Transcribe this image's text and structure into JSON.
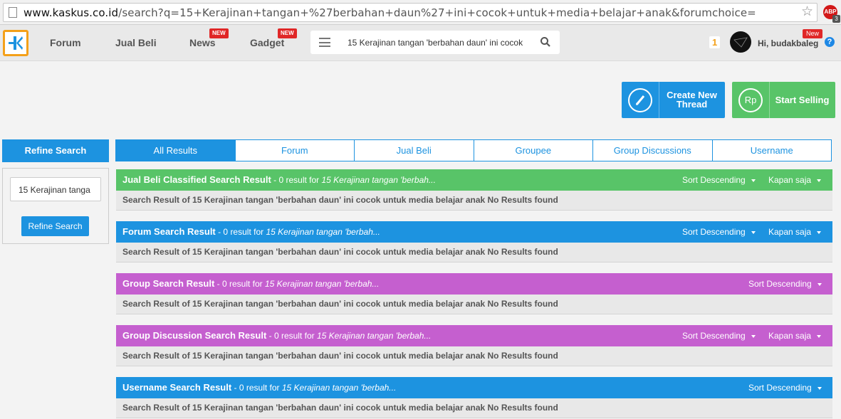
{
  "browser": {
    "url_host": "www.kaskus.co.id",
    "url_path": "/search?q=15+Kerajinan+tangan+%27berbahan+daun%27+ini+cocok+untuk+media+belajar+anak&forumchoice=",
    "star": "☆",
    "adblock": "ABP",
    "adblock_count": "3"
  },
  "header": {
    "nav": [
      {
        "label": "Forum"
      },
      {
        "label": "Jual Beli"
      },
      {
        "label": "News",
        "badge": "NEW"
      },
      {
        "label": "Gadget",
        "badge": "NEW"
      }
    ],
    "search_query": "15 Kerajinan tangan 'berbahan daun' ini cocok",
    "notif_count": "1",
    "greeting": "Hi, budakbaleg",
    "user_badge": "New",
    "help": "?"
  },
  "actions": {
    "create_thread": "Create New Thread",
    "start_selling": "Start Selling",
    "rp_icon": "Rp"
  },
  "refine": {
    "title": "Refine Search",
    "input_value": "15 Kerajinan tanga",
    "button": "Refine Search"
  },
  "tabs": [
    "All Results",
    "Forum",
    "Jual Beli",
    "Groupee",
    "Group Discussions",
    "Username"
  ],
  "sections": [
    {
      "title": "Jual Beli Classified Search Result",
      "sub": " - 0 result for ",
      "query": "15 Kerajinan tangan 'berbah...",
      "sort": "Sort Descending",
      "time": "Kapan saja",
      "color": "#58c468",
      "body": "Search Result of 15 Kerajinan tangan 'berbahan daun' ini cocok untuk media belajar anak No Results found"
    },
    {
      "title": "Forum Search Result",
      "sub": " - 0 result for ",
      "query": "15 Kerajinan tangan 'berbah...",
      "sort": "Sort Descending",
      "time": "Kapan saja",
      "color": "#1d93e0",
      "body": "Search Result of 15 Kerajinan tangan 'berbahan daun' ini cocok untuk media belajar anak No Results found"
    },
    {
      "title": "Group Search Result",
      "sub": " - 0 result for ",
      "query": "15 Kerajinan tangan 'berbah...",
      "sort": "Sort Descending",
      "time": "",
      "color": "#c55fcf",
      "body": "Search Result of 15 Kerajinan tangan 'berbahan daun' ini cocok untuk media belajar anak No Results found"
    },
    {
      "title": "Group Discussion Search Result",
      "sub": " - 0 result for ",
      "query": "15 Kerajinan tangan 'berbah...",
      "sort": "Sort Descending",
      "time": "Kapan saja",
      "color": "#c55fcf",
      "body": "Search Result of 15 Kerajinan tangan 'berbahan daun' ini cocok untuk media belajar anak No Results found"
    },
    {
      "title": "Username Search Result",
      "sub": " - 0 result for ",
      "query": "15 Kerajinan tangan 'berbah...",
      "sort": "Sort Descending",
      "time": "",
      "color": "#1d93e0",
      "body": "Search Result of 15 Kerajinan tangan 'berbahan daun' ini cocok untuk media belajar anak No Results found"
    }
  ]
}
